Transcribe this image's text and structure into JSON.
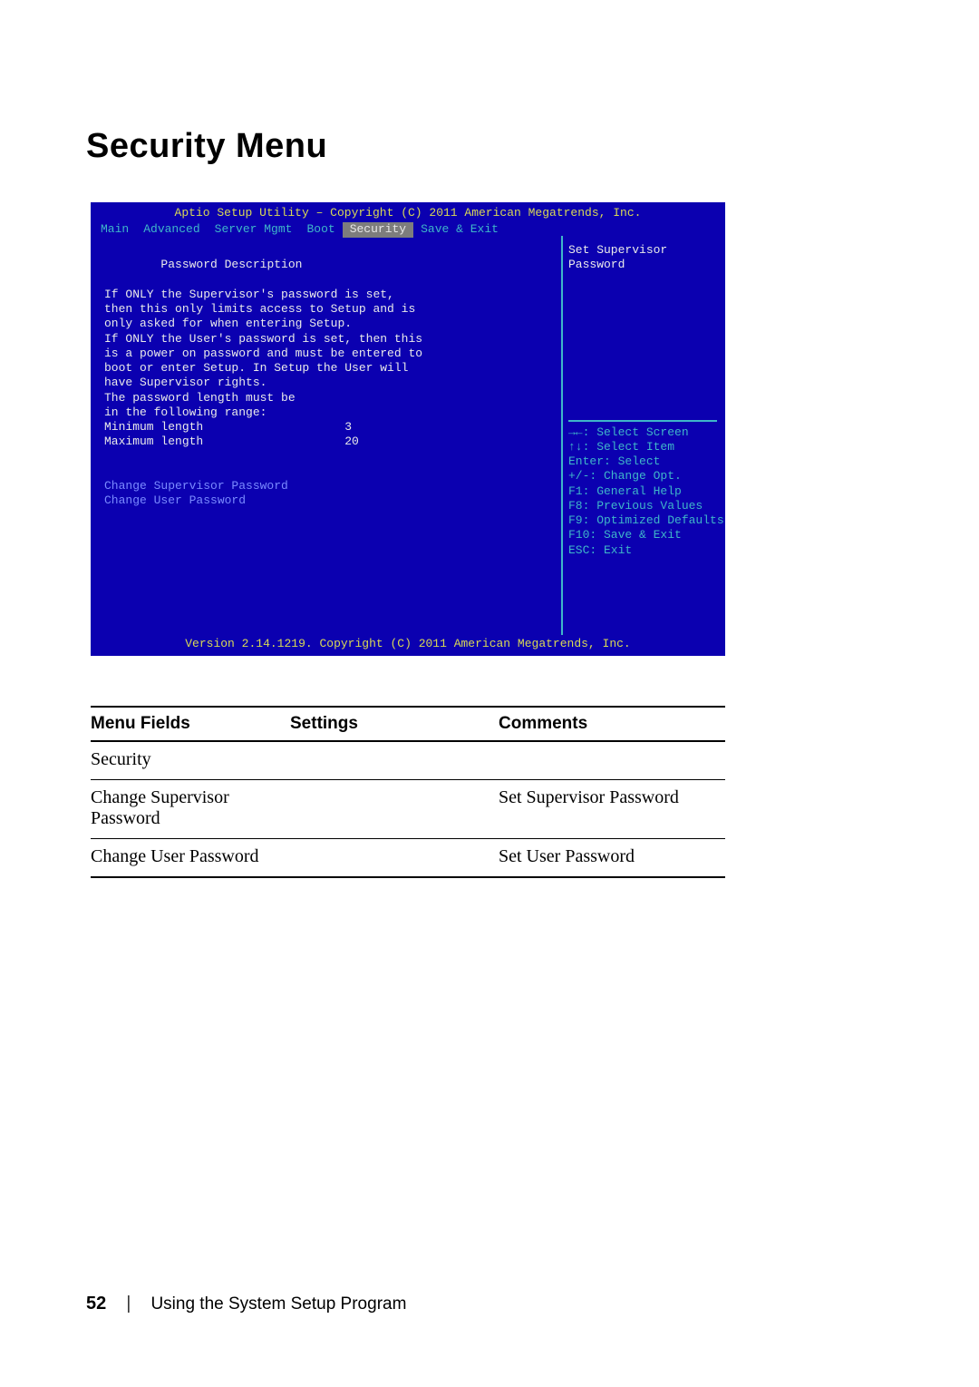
{
  "page": {
    "title": "Security Menu",
    "page_number": "52",
    "chapter": "Using the System Setup Program"
  },
  "bios": {
    "title": "Aptio Setup Utility – Copyright (C) 2011 American Megatrends, Inc.",
    "menubar": [
      "Main",
      "Advanced",
      "Server Mgmt",
      "Boot",
      "Security",
      "Save & Exit"
    ],
    "active_tab_index": 4,
    "left_text": "Password Description\n\nIf ONLY the Supervisor's password is set,\nthen this only limits access to Setup and is\nonly asked for when entering Setup.\nIf ONLY the User's password is set, then this\nis a power on password and must be entered to\nboot or enter Setup. In Setup the User will\nhave Supervisor rights.\nThe password length must be\nin the following range:\nMinimum length                    3\nMaximum length                    20\n\n\n",
    "left_dim_items": [
      "Change Supervisor Password",
      "Change User Password"
    ],
    "right_help_title": "Set Supervisor\nPassword",
    "keys": "→←: Select Screen\n↑↓: Select Item\nEnter: Select\n+/-: Change Opt.\nF1: General Help\nF8: Previous Values\nF9: Optimized Defaults\nF10: Save & Exit\nESC: Exit",
    "footer": "Version 2.14.1219. Copyright (C) 2011 American Megatrends, Inc."
  },
  "table": {
    "headers": [
      "Menu Fields",
      "Settings",
      "Comments"
    ],
    "rows": [
      {
        "field": "Security",
        "settings": "",
        "comments": ""
      },
      {
        "field": "Change Supervisor Password",
        "settings": "",
        "comments": "Set Supervisor Password"
      },
      {
        "field": "Change User Password",
        "settings": "",
        "comments": "Set User Password"
      }
    ]
  }
}
